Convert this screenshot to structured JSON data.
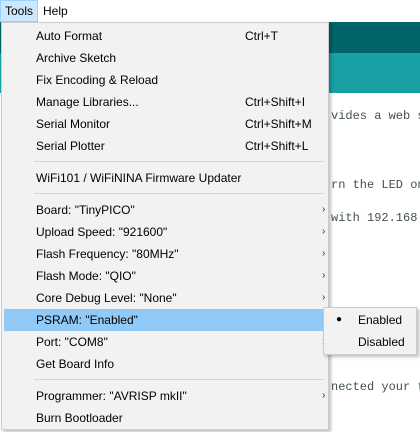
{
  "menubar": {
    "tools": "Tools",
    "help": "Help"
  },
  "colors": {
    "teal_dark": "#006468",
    "teal": "#17a1a5",
    "highlight": "#91c9f7",
    "menu_bg": "#f2f2f2"
  },
  "code_fragments": [
    "vides a web s",
    "rn the LED on",
    "with 192.168.",
    "nected your t"
  ],
  "menu": {
    "auto_format": {
      "label": "Auto Format",
      "shortcut": "Ctrl+T"
    },
    "archive_sketch": {
      "label": "Archive Sketch"
    },
    "fix_encoding": {
      "label": "Fix Encoding & Reload"
    },
    "manage_libraries": {
      "label": "Manage Libraries...",
      "shortcut": "Ctrl+Shift+I"
    },
    "serial_monitor": {
      "label": "Serial Monitor",
      "shortcut": "Ctrl+Shift+M"
    },
    "serial_plotter": {
      "label": "Serial Plotter",
      "shortcut": "Ctrl+Shift+L"
    },
    "wifi_updater": {
      "label": "WiFi101 / WiFiNINA Firmware Updater"
    },
    "board": {
      "label": "Board: \"TinyPICO\""
    },
    "upload_speed": {
      "label": "Upload Speed: \"921600\""
    },
    "flash_frequency": {
      "label": "Flash Frequency: \"80MHz\""
    },
    "flash_mode": {
      "label": "Flash Mode: \"QIO\""
    },
    "core_debug": {
      "label": "Core Debug Level: \"None\""
    },
    "psram": {
      "label": "PSRAM: \"Enabled\""
    },
    "port": {
      "label": "Port: \"COM8\""
    },
    "board_info": {
      "label": "Get Board Info"
    },
    "programmer": {
      "label": "Programmer: \"AVRISP mkII\""
    },
    "burn_bootloader": {
      "label": "Burn Bootloader"
    }
  },
  "psram_submenu": {
    "options": [
      {
        "label": "Enabled",
        "selected": true
      },
      {
        "label": "Disabled",
        "selected": false
      }
    ]
  }
}
